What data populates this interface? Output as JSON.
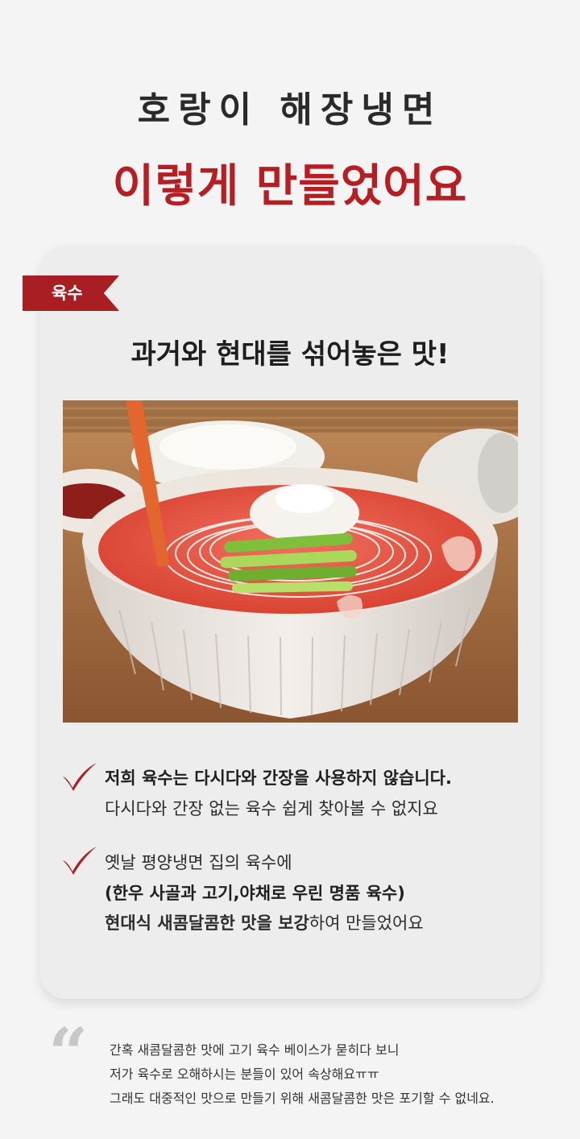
{
  "header": {
    "title_line_1": "호랑이 해장냉면",
    "title_line_2": "이렇게 만들었어요"
  },
  "section": {
    "tag": "육수",
    "heading": "과거와 현대를 섞어놓은 맛!",
    "photo_icon": "photo-naengmyeon-bowl"
  },
  "points": [
    {
      "icon": "checkmark-icon",
      "lines": [
        "저희 육수는 다시다와 간장을 사용하지 않습니다.",
        "다시다와 간장 없는 육수 쉽게 찾아볼 수 없지요"
      ]
    },
    {
      "icon": "checkmark-icon",
      "lines": [
        "옛날 평양냉면 집의 육수에",
        "(한우 사골과 고기,야채로 우린 명품 육수)"
      ],
      "line_3_bold": "현대식 새콤달콤한 맛을 보강",
      "line_3_regular": "하여 만들었어요"
    }
  ],
  "note": {
    "quote_mark": "“",
    "lines": [
      "간혹 새콤달콤한 맛에 고기 육수 베이스가 묻히다 보니",
      "저가 육수로 오해하시는 분들이 있어 속상해요ㅠㅠ",
      "그래도 대중적인 맛으로 만들기 위해 새콤달콤한 맛은 포기할 수 없네요."
    ]
  },
  "colors": {
    "accent_red": "#b51f24",
    "ribbon_red": "#a81e22",
    "card_bg": "#ededed",
    "page_bg": "#f4f4f4"
  }
}
